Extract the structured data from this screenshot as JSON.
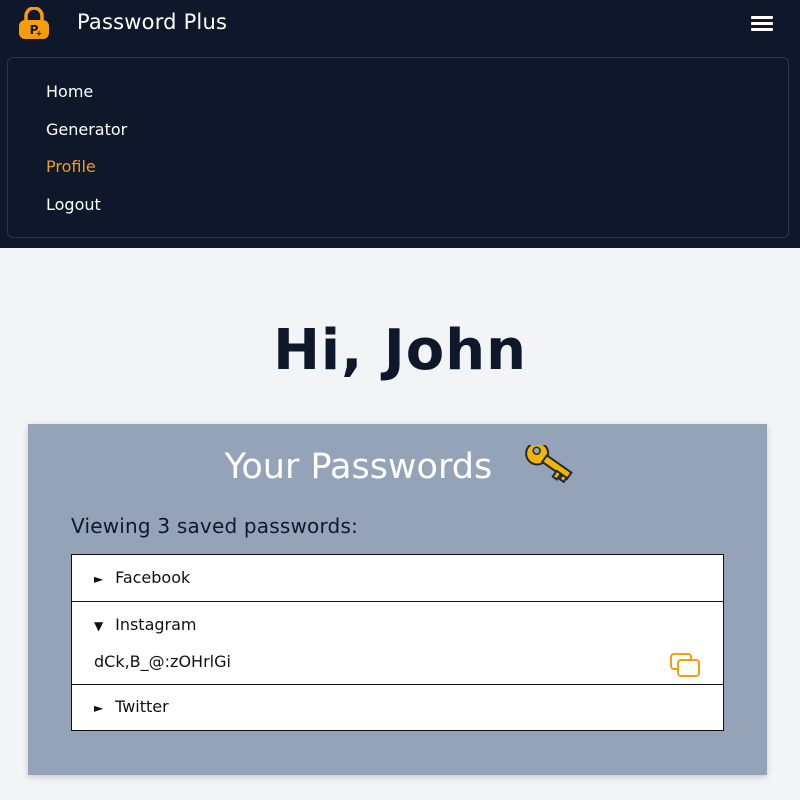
{
  "header": {
    "brand": "Password Plus",
    "logo_icon": "padlock-icon",
    "menu_icon": "hamburger-icon",
    "accent_color": "#f59e0b",
    "background": "#0f172a"
  },
  "nav": {
    "items": [
      {
        "label": "Home"
      },
      {
        "label": "Generator"
      },
      {
        "label": "Profile",
        "active": true
      },
      {
        "label": "Logout"
      }
    ]
  },
  "main": {
    "greeting": "Hi, John",
    "card": {
      "title": "Your Passwords",
      "title_icon": "key-icon",
      "viewing_text": "Viewing 3 saved passwords:",
      "entries": [
        {
          "name": "Facebook",
          "expanded": false,
          "toggle": "►"
        },
        {
          "name": "Instagram",
          "expanded": true,
          "toggle": "▼",
          "password": "dCk,B_@:zOHrlGi",
          "copy_icon": "copy-icon"
        },
        {
          "name": "Twitter",
          "expanded": false,
          "toggle": "►"
        }
      ]
    }
  }
}
